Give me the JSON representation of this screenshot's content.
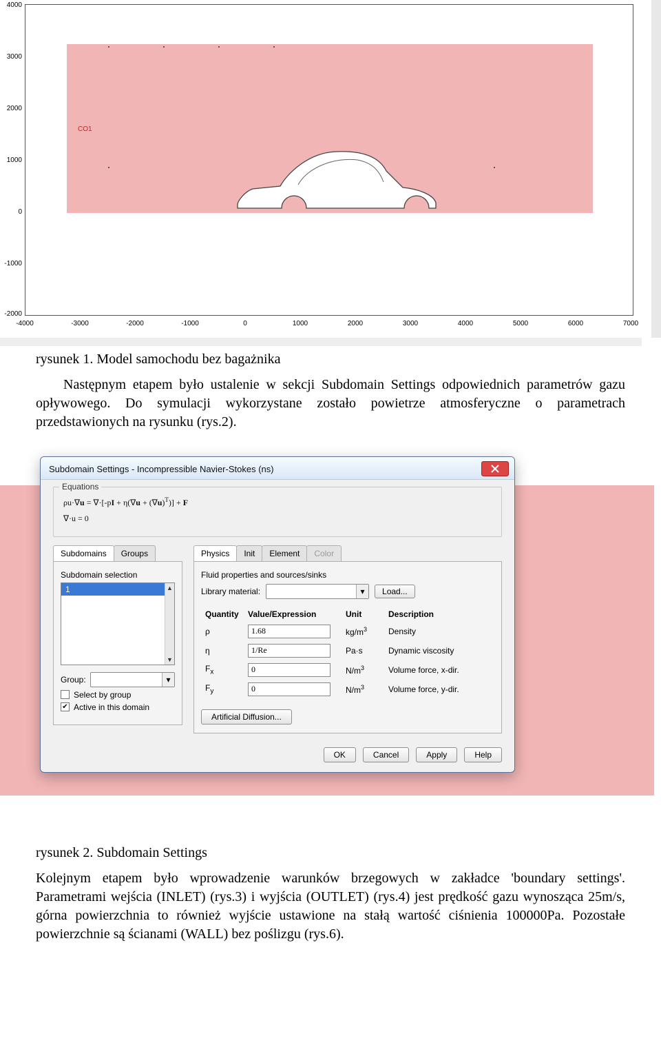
{
  "chart_data": {
    "type": "area",
    "title": "",
    "xlabel": "",
    "ylabel": "",
    "xlim": [
      -4000,
      7000
    ],
    "ylim": [
      -2000,
      4000
    ],
    "xticks": [
      -4000,
      -3000,
      -2000,
      -1000,
      0,
      1000,
      2000,
      3000,
      4000,
      5000,
      6000,
      7000
    ],
    "yticks": [
      -2000,
      -1000,
      0,
      1000,
      2000,
      3000,
      4000
    ],
    "regions": [
      {
        "name": "CO1",
        "x": [
          -3250,
          6250
        ],
        "y": [
          0,
          3250
        ],
        "fill": "#f2b5b5",
        "hole": "car-silhouette"
      }
    ],
    "label_pos": {
      "CO1": {
        "x": -3050,
        "y": 1650
      }
    }
  },
  "captions": {
    "fig1": "rysunek 1. Model samochodu bez bagażnika",
    "fig2": "rysunek 2. Subdomain Settings"
  },
  "para1": "Następnym etapem było ustalenie w sekcji Subdomain Settings odpowiednich parametrów gazu opływowego. Do symulacji wykorzystane zostało powietrze atmosferyczne o parametrach przedstawionych na rysunku (rys.2).",
  "para2": "Kolejnym etapem było wprowadzenie warunków brzegowych w zakładce 'boundary settings'. Parametrami wejścia (INLET) (rys.3) i wyjścia (OUTLET) (rys.4) jest prędkość gazu wynosząca 25m/s, górna powierzchnia to również wyjście ustawione na stałą wartość ciśnienia 100000Pa. Pozostałe powierzchnie są ścianami (WALL) bez poślizgu (rys.6).",
  "dialog": {
    "title": "Subdomain Settings - Incompressible Navier-Stokes (ns)",
    "equations_label": "Equations",
    "eq1": "ρu·∇u = ∇·[-pI + η(∇u + (∇u)ᵀ)] + F",
    "eq2": "∇·u = 0",
    "left_tabs": {
      "subdomains": "Subdomains",
      "groups": "Groups",
      "active": "Subdomains"
    },
    "sel_label": "Subdomain selection",
    "sel_items": [
      "1"
    ],
    "sel_selected": "1",
    "group_label": "Group:",
    "group_value": "",
    "chk_selectbygroup": {
      "label": "Select by group",
      "checked": false
    },
    "chk_active": {
      "label": "Active in this domain",
      "checked": true
    },
    "right_tabs": {
      "items": [
        "Physics",
        "Init",
        "Element",
        "Color"
      ],
      "active": "Physics",
      "disabled": [
        "Color"
      ]
    },
    "fluid_header": "Fluid properties and sources/sinks",
    "libmat_label": "Library material:",
    "libmat_value": "",
    "load_btn": "Load...",
    "colhead": {
      "q": "Quantity",
      "v": "Value/Expression",
      "u": "Unit",
      "d": "Description"
    },
    "rows": [
      {
        "q": "ρ",
        "v": "1.68",
        "u": "kg/m³",
        "d": "Density"
      },
      {
        "q": "η",
        "v": "1/Re",
        "u": "Pa·s",
        "d": "Dynamic viscosity"
      },
      {
        "q": "Fₓ",
        "v": "0",
        "u": "N/m³",
        "d": "Volume force, x-dir."
      },
      {
        "q": "Fᵧ",
        "v": "0",
        "u": "N/m³",
        "d": "Volume force, y-dir."
      }
    ],
    "artdiff_btn": "Artificial Diffusion...",
    "buttons": {
      "ok": "OK",
      "cancel": "Cancel",
      "apply": "Apply",
      "help": "Help"
    }
  }
}
